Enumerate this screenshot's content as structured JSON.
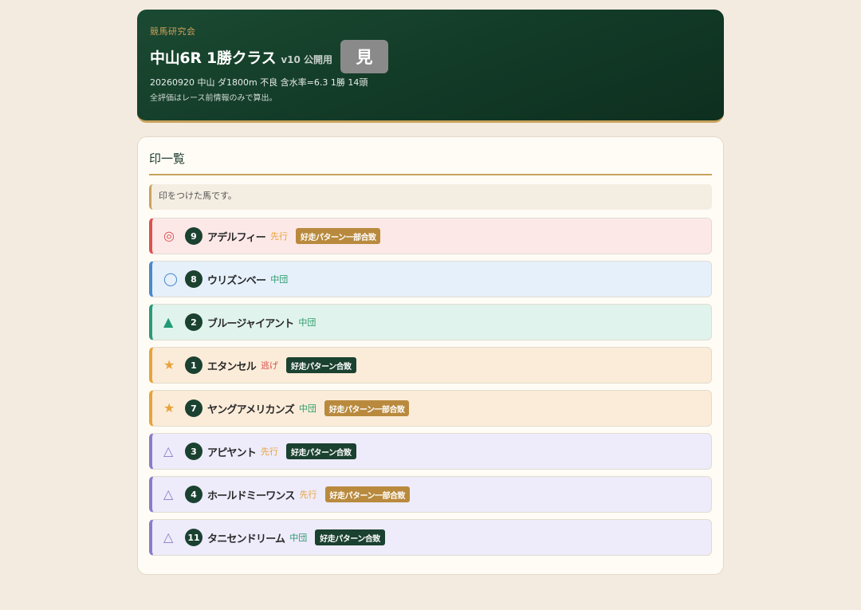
{
  "header": {
    "org": "競馬研究会",
    "title": "中山6R 1勝クラス",
    "version": "v10 公開用",
    "badge": "見",
    "meta": "20260920 中山 ダ1800m 不良 含水率=6.3 1勝 14頭",
    "note": "全評価はレース前情報のみで算出。"
  },
  "section": {
    "title": "印一覧",
    "info": "印をつけた馬です。"
  },
  "rows": [
    {
      "mark": "◎",
      "number": "9",
      "name": "アデルフィー",
      "style": "先行",
      "tag": "好走パターン一部合致"
    },
    {
      "mark": "◯",
      "number": "8",
      "name": "ウリズンベー",
      "style": "中団",
      "tag": ""
    },
    {
      "mark": "▲",
      "number": "2",
      "name": "ブルージャイアント",
      "style": "中団",
      "tag": ""
    },
    {
      "mark": "★",
      "number": "1",
      "name": "エタンセル",
      "style": "逃げ",
      "tag": "好走パターン合致"
    },
    {
      "mark": "★",
      "number": "7",
      "name": "ヤングアメリカンズ",
      "style": "中団",
      "tag": "好走パターン一部合致"
    },
    {
      "mark": "△",
      "number": "3",
      "name": "アピヤント",
      "style": "先行",
      "tag": "好走パターン合致"
    },
    {
      "mark": "△",
      "number": "4",
      "name": "ホールドミーワンス",
      "style": "先行",
      "tag": "好走パターン一部合致"
    },
    {
      "mark": "△",
      "number": "11",
      "name": "タニセンドリーム",
      "style": "中団",
      "tag": "好走パターン合致"
    }
  ],
  "colors": {
    "honmei_bg": "#fde8e8",
    "honmei_border": "#d9534f",
    "honmei_mark": "#d9534f",
    "taikou_bg": "#e6f0fb",
    "taikou_border": "#4a88cc",
    "taikou_mark": "#4a88cc",
    "tanana_bg": "#e0f3ec",
    "tanana_border": "#2a9a78",
    "tanana_mark": "#1f9a74",
    "hoshi_bg": "#fbecd9",
    "hoshi_border": "#e8a33a",
    "hoshi_mark": "#e8a33a",
    "renka_bg": "#eeebfb",
    "renka_border": "#8a7cc9",
    "renka_mark": "#8a7cc9",
    "senko": "#e8a33a",
    "chudan": "#2a9a6a",
    "nige": "#d9534f",
    "tag_partial": "#b98a3e",
    "tag_full": "#1b4130"
  }
}
